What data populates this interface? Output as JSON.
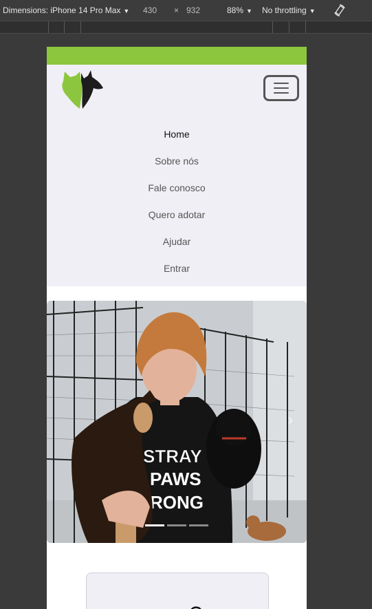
{
  "devtools": {
    "dimensions_label": "Dimensions: iPhone 14 Pro Max",
    "width": "430",
    "times": "×",
    "height": "932",
    "zoom": "88%",
    "throttling": "No throttling"
  },
  "site": {
    "nav": {
      "items": [
        {
          "label": "Home",
          "active": true
        },
        {
          "label": "Sobre nós",
          "active": false
        },
        {
          "label": "Fale conosco",
          "active": false
        },
        {
          "label": "Quero adotar",
          "active": false
        },
        {
          "label": "Ajudar",
          "active": false
        },
        {
          "label": "Entrar",
          "active": false
        }
      ]
    },
    "carousel": {
      "slides": 3,
      "active_slide": 1,
      "shirt_text": "STRAY PAWS & RONG"
    }
  },
  "colors": {
    "brand_green": "#8cc63f",
    "header_bg": "#f0eff5"
  }
}
